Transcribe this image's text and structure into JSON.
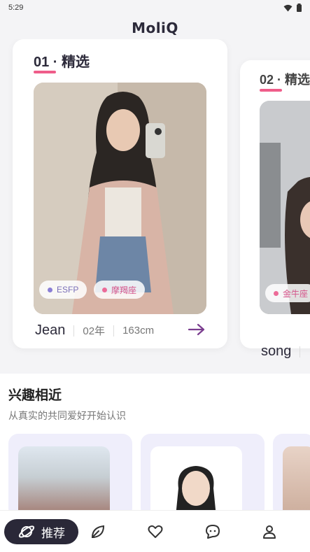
{
  "status_bar": {
    "time": "5:29"
  },
  "header": {
    "logo": "MoliQ"
  },
  "featured": {
    "cards": [
      {
        "title": "01 · 精选",
        "name": "Jean",
        "year": "02年",
        "height": "163cm",
        "tags": [
          "ESFP",
          "摩羯座"
        ]
      },
      {
        "title": "02 · 精选",
        "name": "song",
        "tags": [
          "金牛座"
        ]
      }
    ]
  },
  "interest": {
    "title": "兴趣相近",
    "subtitle": "从真实的共同爱好开始认识"
  },
  "bottom_nav": {
    "active_label": "推荐",
    "items": [
      "recommend",
      "moments",
      "likes",
      "messages",
      "profile"
    ]
  },
  "colors": {
    "accent_pink": "#ef5d8a",
    "purple_tag": "#8a7fd6",
    "nav_dark": "#2a2838"
  }
}
